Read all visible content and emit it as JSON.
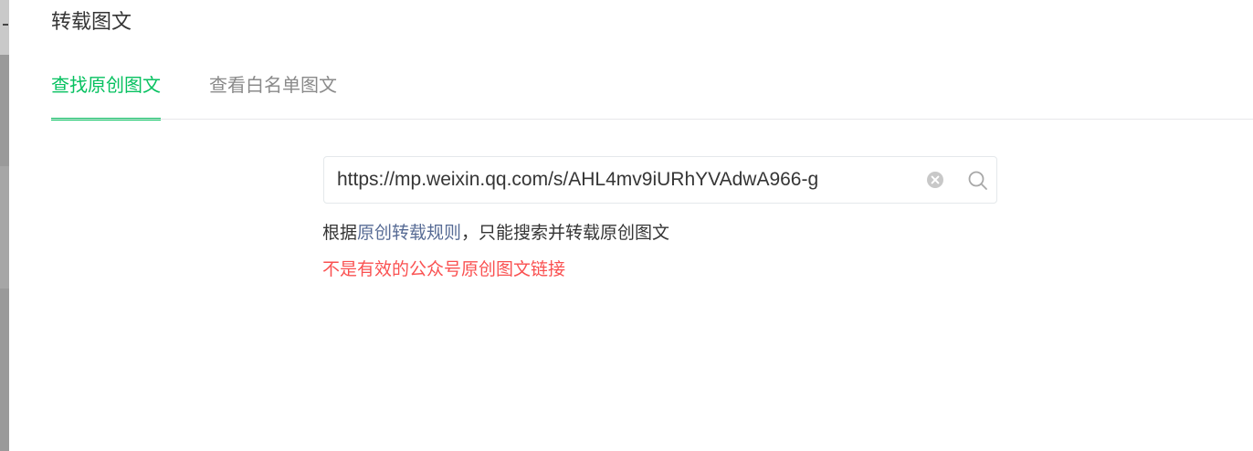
{
  "dialog": {
    "title": "转载图文"
  },
  "tabs": [
    {
      "label": "查找原创图文",
      "active": true
    },
    {
      "label": "查看白名单图文",
      "active": false
    }
  ],
  "search": {
    "value": "https://mp.weixin.qq.com/s/AHL4mv9iURhYVAdwA966-g",
    "clear_icon": "circle-x-icon",
    "search_icon": "magnifier-icon"
  },
  "tip": {
    "prefix": "根据",
    "link": "原创转载规则",
    "suffix": "，只能搜索并转载原创图文"
  },
  "error": {
    "message": "不是有效的公众号原创图文链接"
  },
  "colors": {
    "accent": "#07c160",
    "link": "#576b95",
    "error": "#fa5151"
  }
}
